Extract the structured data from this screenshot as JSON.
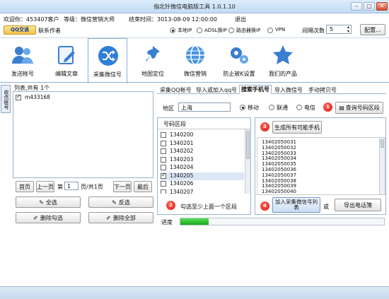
{
  "window": {
    "title": "指北针微信电脑版工具 1.0.1.10"
  },
  "info": {
    "welcome": "欢迎你：453407客户",
    "level": "等级：微信营销大师",
    "expires": "结束时间：3013-08-09 12:00:00",
    "logout": "退出"
  },
  "subbar": {
    "qq_label": "QQ交谈",
    "contact": "联系作者",
    "proxy_options": [
      "本地IP",
      "ADSL换IP",
      "路由器换IP",
      "VPN"
    ],
    "interval_label": "间隔次数",
    "interval_value": "5",
    "config_button": "配置..."
  },
  "toolbar": [
    {
      "label": "发送帐号",
      "icon": "users-icon"
    },
    {
      "label": "编辑文章",
      "icon": "edit-icon"
    },
    {
      "label": "采集微信号",
      "icon": "shuffle-icon"
    },
    {
      "label": "地图定位",
      "icon": "pin-icon"
    },
    {
      "label": "微信营销",
      "icon": "globe-icon"
    },
    {
      "label": "防止被K设置",
      "icon": "gears-icon"
    },
    {
      "label": "我们的产品",
      "icon": "star-icon"
    }
  ],
  "sidetab": "收信帐号",
  "left_panel": {
    "list_title": "列表,共有 1个",
    "items": [
      {
        "text": "m433168",
        "checked": true
      }
    ],
    "first": "首页",
    "prev": "上一页",
    "page_prefix": "第",
    "page_value": "1",
    "page_suffix": "页/共1页",
    "next": "下一页",
    "last": "最后",
    "select_all": "全选",
    "invert": "反选",
    "delete_checked": "删除勾选",
    "delete_all": "删除全部"
  },
  "tabs": [
    "采集QQ帐号",
    "导入或加入qq号",
    "搜索手机号",
    "导入微信号",
    "手动拷贝号"
  ],
  "area": {
    "label": "地区",
    "value": "上海",
    "carriers": [
      "移动",
      "联通",
      "电信"
    ],
    "query_button": "查询号码区段"
  },
  "segments": {
    "header": "号码区段",
    "items": [
      {
        "text": "1340200",
        "checked": false
      },
      {
        "text": "1340201",
        "checked": false
      },
      {
        "text": "1340202",
        "checked": false
      },
      {
        "text": "1340203",
        "checked": false
      },
      {
        "text": "1340204",
        "checked": false
      },
      {
        "text": "1340205",
        "checked": true
      },
      {
        "text": "1340206",
        "checked": false
      },
      {
        "text": "1340207",
        "checked": false
      }
    ],
    "hint": "勾选至少上面一个区段"
  },
  "generate": {
    "button": "生成所有可能手机",
    "numbers": [
      "13402050031",
      "13402050032",
      "13402050033",
      "13402050034",
      "13402050035",
      "13402050036",
      "13402050037",
      "13402050038",
      "13402050039",
      "13402050040"
    ],
    "add_button": "加入采集微信号列表",
    "or": "或",
    "export_button": "导出电话簿"
  },
  "badges": [
    "1",
    "2",
    "3",
    "4"
  ],
  "progress": {
    "label": "进度",
    "value": 0.14
  },
  "colors": {
    "accent": "#3b7fd1",
    "badge": "#dd2222",
    "progress": "#22b022"
  }
}
